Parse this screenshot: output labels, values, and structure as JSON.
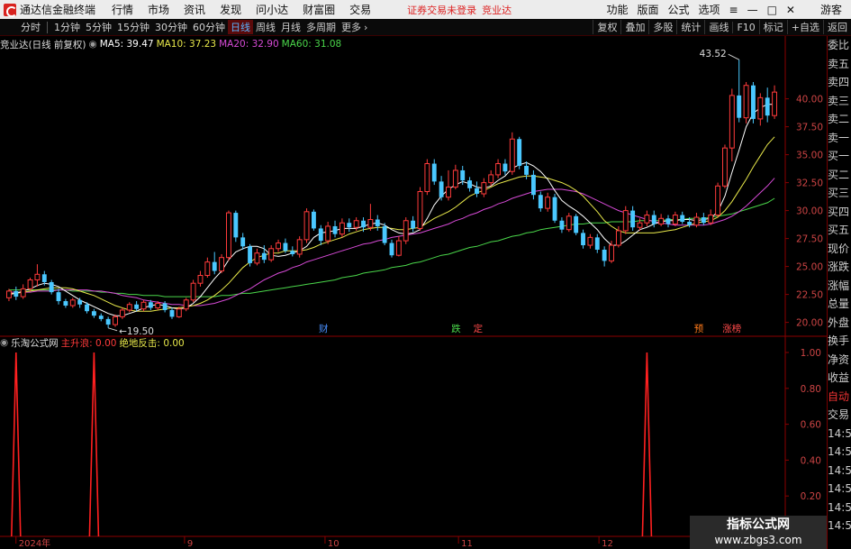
{
  "titlebar": {
    "app_title": "通达信金融终端",
    "menu": [
      "行情",
      "市场",
      "资讯",
      "发现",
      "问小达",
      "财富圈",
      "交易"
    ],
    "notice": "证券交易未登录",
    "stock": "竞业达",
    "right": [
      "功能",
      "版面",
      "公式",
      "选项"
    ],
    "guest": "游客"
  },
  "toolbar": {
    "periods": [
      "分时",
      "1分钟",
      "5分钟",
      "15分钟",
      "30分钟",
      "60分钟",
      "日线",
      "周线",
      "月线",
      "多周期",
      "更多"
    ],
    "active": "日线",
    "right": [
      "复权",
      "叠加",
      "多股",
      "统计",
      "画线",
      "F10",
      "标记",
      "+自选",
      "返回"
    ]
  },
  "main_chart": {
    "header": "竞业达(日线 前复权)",
    "ma": [
      {
        "label": "MA5: 39.47",
        "color": "#ffffff"
      },
      {
        "label": "MA10: 37.23",
        "color": "#e8e84a"
      },
      {
        "label": "MA20: 32.90",
        "color": "#d64ad6"
      },
      {
        "label": "MA60: 31.08",
        "color": "#4ad64a"
      }
    ],
    "price_axis": [
      "40.00",
      "37.50",
      "35.00",
      "32.50",
      "30.00",
      "27.50",
      "25.00",
      "22.50",
      "20.00"
    ],
    "high_label": "43.52",
    "low_label": "19.50",
    "markers": [
      {
        "text": "财",
        "color": "#4a90ff"
      },
      {
        "text": "跌",
        "color": "#4ad64a"
      },
      {
        "text": "定",
        "color": "#ff4a4a"
      },
      {
        "text": "预",
        "color": "#ff7a1a"
      },
      {
        "text": "涨榜",
        "color": "#ff4a4a"
      }
    ]
  },
  "indicator": {
    "name": "乐淘公式网",
    "fields": [
      {
        "label": "主升浪: 0.00",
        "color": "#ff3a3a"
      },
      {
        "label": "绝地反击: 0.00",
        "color": "#e8e84a"
      }
    ],
    "axis": [
      "1.00",
      "0.80",
      "0.60",
      "0.40",
      "0.20"
    ]
  },
  "date_axis": [
    "2024年",
    "9",
    "10",
    "11",
    "12",
    "1"
  ],
  "side_panel": [
    "委比",
    "卖五",
    "卖四",
    "卖三",
    "卖二",
    "卖一",
    "买一",
    "买二",
    "买三",
    "买四",
    "买五",
    "现价",
    "涨跌",
    "涨幅",
    "总量",
    "外盘",
    "换手",
    "净资",
    "收益"
  ],
  "side_panel_lower": [
    "自动",
    "交易",
    "14:56",
    "14:56",
    "14:56",
    "14:56",
    "14:56",
    "14:56",
    "14:56",
    "14:56",
    "14:56"
  ],
  "watermark": {
    "title": "指标公式网",
    "url": "www.zbgs3.com"
  },
  "chart_data": {
    "type": "candlestick",
    "ylim": [
      19,
      44
    ],
    "candles": [
      [
        22.2,
        22.8,
        23.0,
        21.9
      ],
      [
        22.8,
        22.3,
        23.2,
        22.0
      ],
      [
        22.3,
        23.0,
        23.4,
        22.1
      ],
      [
        23.0,
        23.8,
        24.0,
        22.8
      ],
      [
        23.8,
        24.3,
        25.2,
        23.2
      ],
      [
        24.3,
        23.6,
        24.6,
        23.3
      ],
      [
        23.6,
        22.7,
        23.8,
        22.5
      ],
      [
        22.7,
        21.9,
        23.0,
        21.6
      ],
      [
        21.9,
        21.5,
        22.1,
        21.3
      ],
      [
        21.5,
        22.0,
        22.2,
        21.3
      ],
      [
        22.0,
        21.6,
        22.2,
        21.3
      ],
      [
        21.6,
        21.0,
        21.8,
        20.8
      ],
      [
        21.0,
        20.6,
        21.2,
        20.4
      ],
      [
        20.6,
        20.3,
        20.8,
        20.1
      ],
      [
        20.3,
        19.8,
        20.5,
        19.5
      ],
      [
        19.8,
        20.5,
        20.7,
        19.6
      ],
      [
        20.5,
        21.1,
        21.3,
        20.3
      ],
      [
        21.1,
        21.6,
        21.8,
        20.9
      ],
      [
        21.6,
        21.2,
        21.9,
        21.0
      ],
      [
        21.2,
        21.8,
        22.0,
        21.0
      ],
      [
        21.8,
        21.3,
        22.0,
        21.1
      ],
      [
        21.3,
        21.7,
        21.9,
        21.1
      ],
      [
        21.7,
        21.1,
        21.9,
        20.9
      ],
      [
        21.1,
        20.5,
        21.3,
        20.3
      ],
      [
        20.5,
        21.2,
        21.4,
        20.4
      ],
      [
        21.2,
        22.0,
        22.2,
        21.0
      ],
      [
        22.0,
        23.5,
        23.8,
        21.8
      ],
      [
        23.5,
        24.2,
        24.6,
        23.2
      ],
      [
        24.2,
        25.4,
        25.8,
        24.0
      ],
      [
        25.4,
        24.6,
        26.3,
        24.3
      ],
      [
        24.6,
        25.8,
        26.1,
        24.4
      ],
      [
        25.8,
        29.8,
        30.0,
        25.5
      ],
      [
        29.8,
        27.6,
        30.0,
        27.2
      ],
      [
        27.6,
        26.8,
        28.0,
        26.5
      ],
      [
        26.8,
        25.3,
        27.0,
        25.0
      ],
      [
        25.3,
        26.2,
        26.6,
        25.1
      ],
      [
        26.2,
        25.6,
        26.9,
        25.3
      ],
      [
        25.6,
        26.6,
        26.9,
        25.4
      ],
      [
        26.6,
        27.1,
        27.4,
        26.3
      ],
      [
        27.1,
        26.4,
        27.5,
        26.2
      ],
      [
        26.4,
        26.1,
        26.8,
        25.9
      ],
      [
        26.1,
        27.4,
        27.7,
        25.8
      ],
      [
        27.4,
        29.9,
        30.2,
        27.1
      ],
      [
        29.9,
        28.4,
        30.1,
        28.2
      ],
      [
        28.4,
        27.3,
        28.7,
        26.9
      ],
      [
        27.3,
        28.6,
        29.0,
        27.0
      ],
      [
        28.6,
        27.9,
        29.1,
        27.6
      ],
      [
        27.9,
        28.9,
        29.3,
        27.6
      ],
      [
        28.9,
        28.5,
        29.3,
        28.1
      ],
      [
        28.5,
        29.1,
        29.4,
        28.2
      ],
      [
        29.1,
        28.5,
        29.4,
        28.1
      ],
      [
        28.5,
        29.2,
        30.6,
        28.2
      ],
      [
        29.2,
        28.6,
        29.6,
        28.2
      ],
      [
        28.6,
        27.1,
        28.9,
        26.9
      ],
      [
        27.1,
        26.0,
        27.4,
        25.8
      ],
      [
        26.0,
        27.3,
        27.7,
        25.9
      ],
      [
        27.3,
        29.1,
        29.4,
        27.0
      ],
      [
        29.1,
        28.4,
        29.5,
        28.1
      ],
      [
        28.4,
        31.7,
        32.1,
        28.2
      ],
      [
        31.7,
        34.2,
        34.6,
        31.4
      ],
      [
        34.2,
        32.6,
        34.6,
        32.3
      ],
      [
        32.6,
        31.2,
        33.1,
        30.9
      ],
      [
        31.2,
        32.1,
        33.6,
        30.9
      ],
      [
        32.1,
        33.6,
        34.1,
        31.9
      ],
      [
        33.6,
        32.7,
        34.0,
        32.3
      ],
      [
        32.7,
        32.0,
        33.0,
        31.7
      ],
      [
        32.0,
        31.5,
        32.6,
        31.2
      ],
      [
        31.5,
        32.5,
        32.9,
        31.2
      ],
      [
        32.5,
        33.2,
        33.6,
        32.2
      ],
      [
        33.2,
        34.2,
        34.6,
        32.9
      ],
      [
        34.2,
        33.5,
        34.6,
        33.2
      ],
      [
        33.5,
        36.4,
        37.0,
        33.2
      ],
      [
        36.4,
        34.0,
        36.6,
        33.7
      ],
      [
        34.0,
        33.2,
        34.4,
        32.8
      ],
      [
        33.2,
        31.4,
        33.6,
        31.0
      ],
      [
        31.4,
        30.2,
        31.7,
        29.9
      ],
      [
        30.2,
        31.2,
        31.6,
        29.9
      ],
      [
        31.2,
        29.1,
        31.5,
        28.9
      ],
      [
        29.1,
        28.3,
        29.4,
        28.0
      ],
      [
        28.3,
        29.5,
        29.8,
        28.1
      ],
      [
        29.5,
        28.0,
        29.7,
        27.8
      ],
      [
        28.0,
        26.9,
        28.3,
        26.6
      ],
      [
        26.9,
        27.6,
        27.9,
        26.6
      ],
      [
        27.6,
        26.5,
        27.9,
        26.2
      ],
      [
        26.5,
        25.5,
        26.8,
        25.0
      ],
      [
        25.5,
        26.9,
        27.3,
        25.3
      ],
      [
        26.9,
        28.2,
        28.6,
        26.7
      ],
      [
        28.2,
        30.0,
        30.4,
        27.9
      ],
      [
        30.0,
        28.5,
        30.4,
        28.2
      ],
      [
        28.5,
        28.9,
        29.3,
        28.2
      ],
      [
        28.9,
        29.6,
        30.0,
        28.6
      ],
      [
        29.6,
        28.8,
        30.0,
        28.5
      ],
      [
        28.8,
        29.3,
        29.7,
        28.6
      ],
      [
        29.3,
        28.8,
        29.6,
        28.5
      ],
      [
        28.8,
        29.6,
        29.9,
        28.6
      ],
      [
        29.6,
        29.0,
        29.9,
        28.8
      ],
      [
        29.0,
        28.7,
        29.4,
        28.5
      ],
      [
        28.7,
        29.4,
        29.8,
        28.5
      ],
      [
        29.4,
        28.9,
        29.8,
        28.7
      ],
      [
        28.9,
        29.6,
        30.1,
        28.7
      ],
      [
        29.6,
        32.2,
        32.5,
        29.4
      ],
      [
        32.2,
        35.6,
        35.9,
        32.0
      ],
      [
        35.6,
        40.3,
        40.9,
        34.4
      ],
      [
        40.3,
        38.3,
        43.5,
        37.9
      ],
      [
        38.3,
        41.2,
        41.5,
        37.8
      ],
      [
        41.2,
        38.2,
        41.5,
        37.8
      ],
      [
        38.2,
        40.1,
        40.5,
        37.6
      ],
      [
        40.1,
        38.5,
        41.0,
        37.9
      ],
      [
        38.5,
        40.6,
        41.2,
        38.2
      ]
    ],
    "ma5": [
      22.5,
      22.6,
      22.8,
      23.0,
      23.3,
      23.5,
      23.4,
      23.2,
      22.8,
      22.4,
      22.0,
      21.7,
      21.4,
      21.1,
      20.8,
      20.6,
      20.6,
      20.8,
      21.0,
      21.3,
      21.5,
      21.6,
      21.5,
      21.3,
      21.2,
      21.3,
      21.7,
      22.3,
      23.1,
      23.9,
      24.6,
      25.6,
      26.3,
      26.6,
      26.8,
      26.8,
      26.6,
      26.0,
      25.9,
      26.0,
      26.2,
      26.4,
      26.8,
      27.6,
      28.0,
      28.1,
      28.2,
      28.4,
      28.4,
      28.4,
      28.6,
      28.8,
      28.9,
      28.7,
      28.3,
      28.0,
      27.9,
      28.0,
      28.3,
      29.3,
      30.5,
      31.3,
      31.9,
      32.3,
      32.6,
      32.4,
      32.1,
      32.0,
      32.2,
      32.7,
      33.1,
      33.8,
      34.1,
      34.3,
      34.0,
      33.5,
      32.8,
      31.8,
      30.9,
      30.4,
      30.0,
      29.5,
      28.9,
      28.3,
      27.5,
      26.9,
      26.9,
      27.3,
      27.8,
      28.3,
      28.5,
      28.8,
      29.0,
      29.1,
      29.1,
      29.2,
      29.2,
      29.1,
      29.2,
      29.3,
      29.9,
      31.3,
      33.4,
      35.4,
      37.5,
      38.7,
      39.2,
      39.5,
      39.5
    ],
    "ma10": [
      22.6,
      22.6,
      22.7,
      22.8,
      22.9,
      23.0,
      23.1,
      23.1,
      23.1,
      23.0,
      22.8,
      22.6,
      22.4,
      22.1,
      21.8,
      21.5,
      21.3,
      21.1,
      21.0,
      21.0,
      21.0,
      21.1,
      21.2,
      21.3,
      21.3,
      21.4,
      21.5,
      21.7,
      22.0,
      22.4,
      22.9,
      23.5,
      24.2,
      24.9,
      25.4,
      25.8,
      26.0,
      26.2,
      26.2,
      26.4,
      26.4,
      26.4,
      26.5,
      26.7,
      27.0,
      27.2,
      27.4,
      27.6,
      27.9,
      28.1,
      28.3,
      28.4,
      28.5,
      28.5,
      28.4,
      28.3,
      28.3,
      28.4,
      28.5,
      28.9,
      29.3,
      29.6,
      29.9,
      30.3,
      30.8,
      31.3,
      31.6,
      31.8,
      32.1,
      32.4,
      32.6,
      32.8,
      33.0,
      33.1,
      33.1,
      33.0,
      32.9,
      32.7,
      32.5,
      32.2,
      31.8,
      31.3,
      30.6,
      29.9,
      29.1,
      28.6,
      28.2,
      28.0,
      28.0,
      28.0,
      28.0,
      28.0,
      28.1,
      28.2,
      28.3,
      28.5,
      28.7,
      28.9,
      29.0,
      29.1,
      29.4,
      30.0,
      30.8,
      31.8,
      32.8,
      33.9,
      34.9,
      35.9,
      36.6
    ],
    "ma20": [
      22.7,
      22.7,
      22.7,
      22.7,
      22.8,
      22.8,
      22.8,
      22.9,
      22.9,
      22.9,
      22.9,
      22.9,
      22.8,
      22.8,
      22.7,
      22.6,
      22.4,
      22.3,
      22.2,
      22.0,
      21.9,
      21.8,
      21.7,
      21.6,
      21.6,
      21.5,
      21.5,
      21.5,
      21.6,
      21.7,
      21.9,
      22.1,
      22.4,
      22.7,
      23.0,
      23.4,
      23.8,
      24.1,
      24.4,
      24.6,
      24.9,
      25.1,
      25.4,
      25.6,
      25.8,
      26.0,
      26.2,
      26.4,
      26.6,
      26.8,
      27.0,
      27.1,
      27.3,
      27.4,
      27.6,
      27.7,
      27.8,
      27.9,
      28.0,
      28.2,
      28.4,
      28.6,
      28.8,
      29.1,
      29.3,
      29.6,
      29.8,
      30.1,
      30.3,
      30.6,
      30.8,
      31.1,
      31.3,
      31.5,
      31.7,
      31.8,
      31.9,
      31.9,
      31.9,
      31.8,
      31.7,
      31.5,
      31.2,
      30.9,
      30.6,
      30.3,
      30.0,
      29.8,
      29.6,
      29.4,
      29.2,
      29.0,
      28.9,
      28.8,
      28.7,
      28.7,
      28.7,
      28.7,
      28.7,
      28.8,
      29.0,
      29.2,
      29.5,
      29.9,
      30.4,
      31.0,
      31.6,
      32.2,
      32.9
    ],
    "ma60": [
      22.9,
      22.9,
      22.9,
      22.9,
      22.9,
      22.9,
      22.9,
      22.9,
      22.9,
      22.8,
      22.8,
      22.8,
      22.8,
      22.7,
      22.7,
      22.6,
      22.6,
      22.5,
      22.5,
      22.4,
      22.4,
      22.4,
      22.3,
      22.3,
      22.3,
      22.3,
      22.3,
      22.3,
      22.3,
      22.3,
      22.4,
      22.4,
      22.5,
      22.6,
      22.6,
      22.7,
      22.8,
      22.9,
      23.0,
      23.1,
      23.2,
      23.3,
      23.4,
      23.5,
      23.6,
      23.7,
      23.8,
      24.0,
      24.1,
      24.2,
      24.4,
      24.5,
      24.6,
      24.7,
      24.9,
      25.0,
      25.1,
      25.3,
      25.4,
      25.6,
      25.8,
      26.0,
      26.1,
      26.3,
      26.5,
      26.7,
      26.8,
      27.0,
      27.2,
      27.3,
      27.5,
      27.7,
      27.8,
      28.0,
      28.1,
      28.3,
      28.4,
      28.5,
      28.6,
      28.7,
      28.8,
      28.8,
      28.9,
      28.9,
      28.9,
      29.0,
      29.0,
      29.0,
      29.0,
      29.1,
      29.1,
      29.1,
      29.1,
      29.2,
      29.2,
      29.2,
      29.3,
      29.3,
      29.3,
      29.4,
      29.5,
      29.6,
      29.7,
      29.9,
      30.1,
      30.3,
      30.5,
      30.7,
      31.1
    ],
    "signal_spikes": [
      1,
      12,
      90
    ]
  }
}
